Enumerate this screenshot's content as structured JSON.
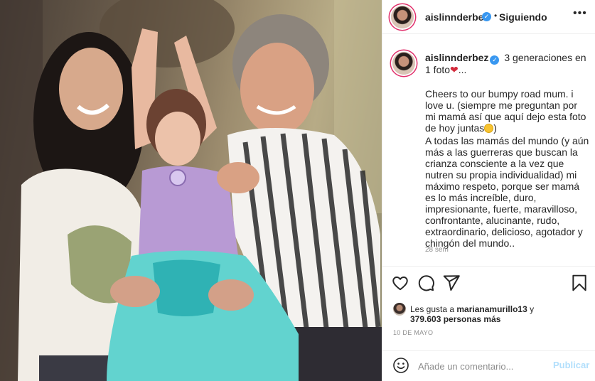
{
  "post": {
    "username": "aislinnderbez",
    "verified_mark": "✓",
    "separator": "•",
    "follow_status": "Siguiendo",
    "more_label": "•••"
  },
  "caption": {
    "username": "aislinnderbez",
    "title_text": "3 generaciones en 1 foto",
    "heart": "❤",
    "ellipsis": "...",
    "paragraph1": "Cheers to our bumpy road mum. i love u. (siempre me preguntan por mi mamá así que aquí dejo esta foto de hoy juntas",
    "paragraph1_end": ")",
    "paragraph2": "A todas las mamás del mundo (y aún más a las guerreras que buscan la crianza consciente a la vez que nutren su propia individualidad) mi máximo respeto, porque ser mamá es lo más increíble, duro, impresionante, fuerte, maravilloso, confrontante, alucinante, rudo, extraordinario, delicioso, agotador y chingón del mundo..",
    "time_ago": "28 sem"
  },
  "actions": {
    "icons": [
      "heart-icon",
      "comment-icon",
      "share-icon",
      "bookmark-icon"
    ]
  },
  "likes": {
    "prefix": "Les gusta a ",
    "liker": "marianamurillo13",
    "conj": " y",
    "count_text": "379.603 personas más"
  },
  "date": "10 DE MAYO",
  "comment_box": {
    "placeholder": "Añade un comentario...",
    "publish_label": "Publicar"
  },
  "colors": {
    "accent_blue": "#3897f0",
    "publish_disabled": "#b2dffc",
    "muted_text": "#8e8e8e",
    "border": "#efefef",
    "heart_red": "#d42a3c"
  }
}
